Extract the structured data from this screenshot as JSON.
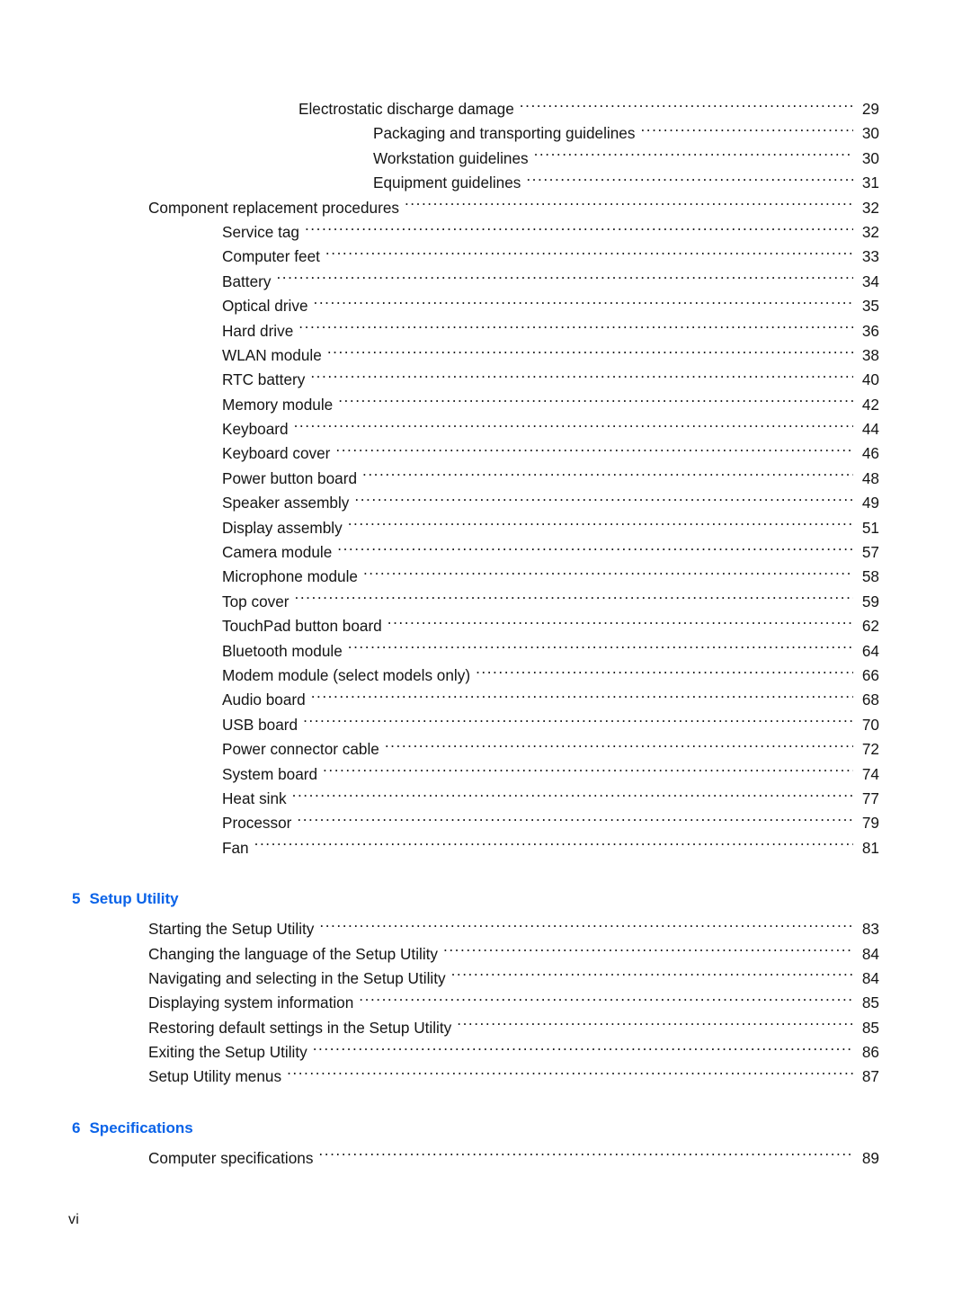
{
  "document": {
    "type": "table-of-contents",
    "folio": "vi",
    "heading_color": "#0a63e8",
    "text_color": "#151515"
  },
  "toc": {
    "entries": [
      {
        "label": "Electrostatic discharge damage",
        "page": "29",
        "level": 3
      },
      {
        "label": "Packaging and transporting guidelines",
        "page": "30",
        "level": 4
      },
      {
        "label": "Workstation guidelines",
        "page": "30",
        "level": 4
      },
      {
        "label": "Equipment guidelines",
        "page": "31",
        "level": 4
      },
      {
        "label": "Component replacement procedures",
        "page": "32",
        "level": 1
      },
      {
        "label": "Service tag",
        "page": "32",
        "level": 2
      },
      {
        "label": "Computer feet",
        "page": "33",
        "level": 2
      },
      {
        "label": "Battery",
        "page": "34",
        "level": 2
      },
      {
        "label": "Optical drive",
        "page": "35",
        "level": 2
      },
      {
        "label": "Hard drive",
        "page": "36",
        "level": 2
      },
      {
        "label": "WLAN module",
        "page": "38",
        "level": 2
      },
      {
        "label": "RTC battery",
        "page": "40",
        "level": 2
      },
      {
        "label": "Memory module",
        "page": "42",
        "level": 2
      },
      {
        "label": "Keyboard",
        "page": "44",
        "level": 2
      },
      {
        "label": "Keyboard cover",
        "page": "46",
        "level": 2
      },
      {
        "label": "Power button board",
        "page": "48",
        "level": 2
      },
      {
        "label": "Speaker assembly",
        "page": "49",
        "level": 2
      },
      {
        "label": "Display assembly",
        "page": "51",
        "level": 2
      },
      {
        "label": "Camera module",
        "page": "57",
        "level": 2
      },
      {
        "label": "Microphone module",
        "page": "58",
        "level": 2
      },
      {
        "label": "Top cover",
        "page": "59",
        "level": 2
      },
      {
        "label": "TouchPad button board",
        "page": "62",
        "level": 2
      },
      {
        "label": "Bluetooth module",
        "page": "64",
        "level": 2
      },
      {
        "label": "Modem module (select models only)",
        "page": "66",
        "level": 2
      },
      {
        "label": "Audio board",
        "page": "68",
        "level": 2
      },
      {
        "label": "USB board",
        "page": "70",
        "level": 2
      },
      {
        "label": "Power connector cable",
        "page": "72",
        "level": 2
      },
      {
        "label": "System board",
        "page": "74",
        "level": 2
      },
      {
        "label": "Heat sink",
        "page": "77",
        "level": 2
      },
      {
        "label": "Processor",
        "page": "79",
        "level": 2
      },
      {
        "label": "Fan",
        "page": "81",
        "level": 2
      }
    ]
  },
  "chapter5": {
    "number": "5",
    "title": "Setup Utility",
    "entries": [
      {
        "label": "Starting the Setup Utility",
        "page": "83",
        "level": 1
      },
      {
        "label": "Changing the language of the Setup Utility",
        "page": "84",
        "level": 1
      },
      {
        "label": "Navigating and selecting in the Setup Utility",
        "page": "84",
        "level": 1
      },
      {
        "label": "Displaying system information",
        "page": "85",
        "level": 1
      },
      {
        "label": "Restoring default settings in the Setup Utility",
        "page": "85",
        "level": 1
      },
      {
        "label": "Exiting the Setup Utility",
        "page": "86",
        "level": 1
      },
      {
        "label": "Setup Utility menus",
        "page": "87",
        "level": 1
      }
    ]
  },
  "chapter6": {
    "number": "6",
    "title": "Specifications",
    "entries": [
      {
        "label": "Computer specifications",
        "page": "89",
        "level": 1
      }
    ]
  }
}
